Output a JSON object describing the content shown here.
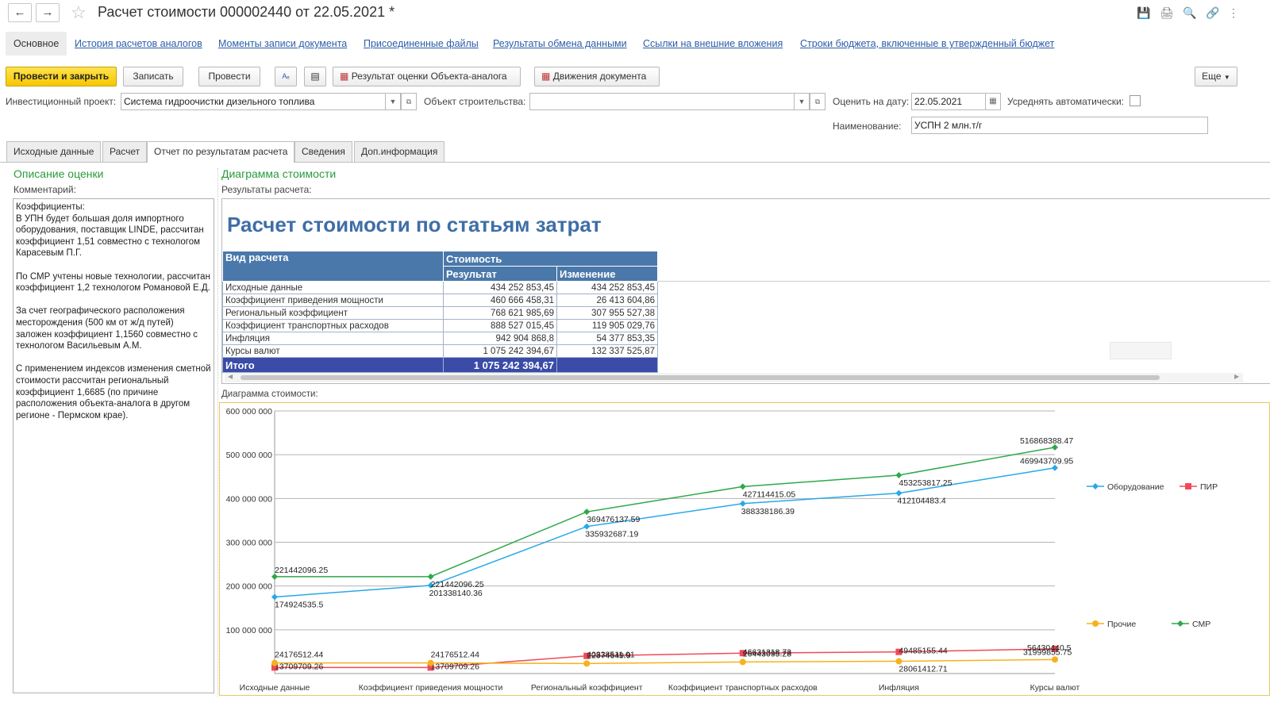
{
  "window": {
    "title": "Расчет стоимости 000002440 от 22.05.2021 *"
  },
  "sections": {
    "main": "Основное",
    "links": [
      "История расчетов аналогов",
      "Моменты записи документа",
      "Присоединенные файлы",
      "Результаты обмена данными",
      "Ссылки на внешние вложения",
      "Строки бюджета, включенные в утвержденный бюджет"
    ]
  },
  "toolbar": {
    "post_close": "Провести и закрыть",
    "save": "Записать",
    "post": "Провести",
    "result_analog": "Результат оценки Объекта-аналога",
    "movements": "Движения документа",
    "more": "Еще"
  },
  "form": {
    "project_label": "Инвестиционный проект:",
    "project_value": "Система гидроочистки дизельного топлива",
    "object_label": "Объект строительства:",
    "object_value": "",
    "date_label": "Оценить на дату:",
    "date_value": "22.05.2021",
    "avg_label": "Усреднять автоматически:",
    "name_label": "Наименование:",
    "name_value": "УСПН 2 млн.т/г"
  },
  "tabs": [
    "Исходные данные",
    "Расчет",
    "Отчет по результатам расчета",
    "Сведения",
    "Доп.информация"
  ],
  "left": {
    "heading": "Описание оценки",
    "comment_label": "Комментарий:",
    "comment": "Коэффициенты:\nВ УПН будет большая доля импортного оборудования, поставщик LINDE, рассчитан коэффициент 1,51 совместно с технологом Карасевым П.Г.\n\nПо СМР учтены новые технологии, рассчитан коэффициент 1,2 технологом Романовой Е.Д.\n\nЗа счет географического расположения месторождения (500 км от ж/д путей) заложен коэффициент 1,1560 совместно с технологом Васильевым А.М.\n\nС применением индексов изменения сметной стоимости рассчитан региональный коэффициент 1,6685 (по причине расположения объекта-аналога в другом регионе - Пермском крае)."
  },
  "right": {
    "heading": "Диаграмма стоимости",
    "results_label": "Результаты расчета:",
    "report_title": "Расчет стоимости по статьям затрат",
    "table": {
      "h_kind": "Вид расчета",
      "h_cost": "Стоимость",
      "h_result": "Результат",
      "h_change": "Изменение",
      "rows": [
        {
          "name": "Исходные данные",
          "result": "434 252 853,45",
          "change": "434 252 853,45"
        },
        {
          "name": "Коэффициент приведения мощности",
          "result": "460 666 458,31",
          "change": "26 413 604,86"
        },
        {
          "name": "Региональный коэффициент",
          "result": "768 621 985,69",
          "change": "307 955 527,38"
        },
        {
          "name": "Коэффициент транспортных расходов",
          "result": "888 527 015,45",
          "change": "119 905 029,76"
        },
        {
          "name": "Инфляция",
          "result": "942 904 868,8",
          "change": "54 377 853,35"
        },
        {
          "name": "Курсы валют",
          "result": "1 075 242 394,67",
          "change": "132 337 525,87"
        }
      ],
      "total_label": "Итого",
      "total_value": "1 075 242 394,67"
    },
    "chart_label": "Диаграмма стоимости:"
  },
  "chart_data": {
    "type": "line",
    "categories": [
      "Исходные данные",
      "Коэффициент приведения мощности",
      "Региональный коэффициент",
      "Коэффициент транспортных расходов",
      "Инфляция",
      "Курсы валют"
    ],
    "ylim": [
      0,
      600000000
    ],
    "yticks": [
      100000000,
      200000000,
      300000000,
      400000000,
      500000000,
      600000000
    ],
    "ytick_labels": [
      "100 000 000",
      "200 000 000",
      "300 000 000",
      "400 000 000",
      "500 000 000",
      "600 000 000"
    ],
    "grid": true,
    "series": [
      {
        "name": "Оборудование",
        "color": "#29a8e8",
        "marker": "diamond",
        "values": [
          174924535.5,
          201338140.36,
          335932687.19,
          388338186.39,
          412104483.4,
          469943709.95
        ],
        "labels": [
          "174924535.5",
          "201338140.36",
          "335932687.19",
          "388338186.39",
          "412104483.4",
          "469943709.95"
        ]
      },
      {
        "name": "ПИР",
        "color": "#f04a5a",
        "marker": "square",
        "values": [
          13709709.26,
          13709709.26,
          40338511.01,
          46631318.73,
          49485155.44,
          56430440.5
        ],
        "labels": [
          "13709709.26",
          "13709709.26",
          "40338511.01",
          "46631318.73",
          "49485155.44",
          "56430440.5"
        ]
      },
      {
        "name": "Прочие",
        "color": "#f5b21c",
        "marker": "circle",
        "values": [
          24176512.44,
          24176512.44,
          22874649.9,
          26443095.28,
          28061412.71,
          31999855.75
        ],
        "labels": [
          "24176512.44",
          "24176512.44",
          "22874649.9",
          "26443095.28",
          "28061412.71",
          "31999855.75"
        ]
      },
      {
        "name": "СМР",
        "color": "#2fa84a",
        "marker": "diamond",
        "values": [
          221442096.25,
          221442096.25,
          369476137.59,
          427114415.05,
          453253817.25,
          516868388.47
        ],
        "labels": [
          "221442096.25",
          "221442096.25",
          "369476137.59",
          "427114415.05",
          "453253817.25",
          "516868388.47"
        ]
      }
    ]
  }
}
